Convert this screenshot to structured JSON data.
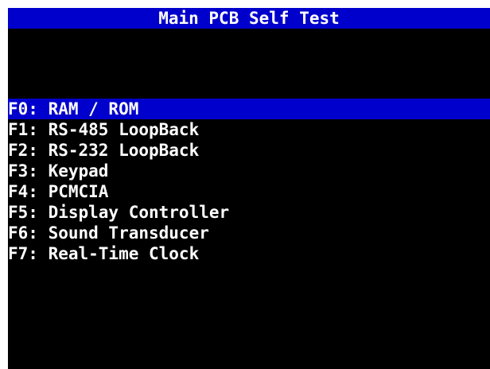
{
  "title": "Main PCB Self Test",
  "colors": {
    "background": "#000000",
    "highlight": "#0000cc",
    "text": "#ffffff"
  },
  "menu": {
    "selected_index": 0,
    "items": [
      {
        "label": "F0: RAM / ROM"
      },
      {
        "label": "F1: RS-485 LoopBack"
      },
      {
        "label": "F2: RS-232 LoopBack"
      },
      {
        "label": "F3: Keypad"
      },
      {
        "label": "F4: PCMCIA"
      },
      {
        "label": "F5: Display Controller"
      },
      {
        "label": "F6: Sound Transducer"
      },
      {
        "label": "F7: Real-Time Clock"
      }
    ]
  }
}
